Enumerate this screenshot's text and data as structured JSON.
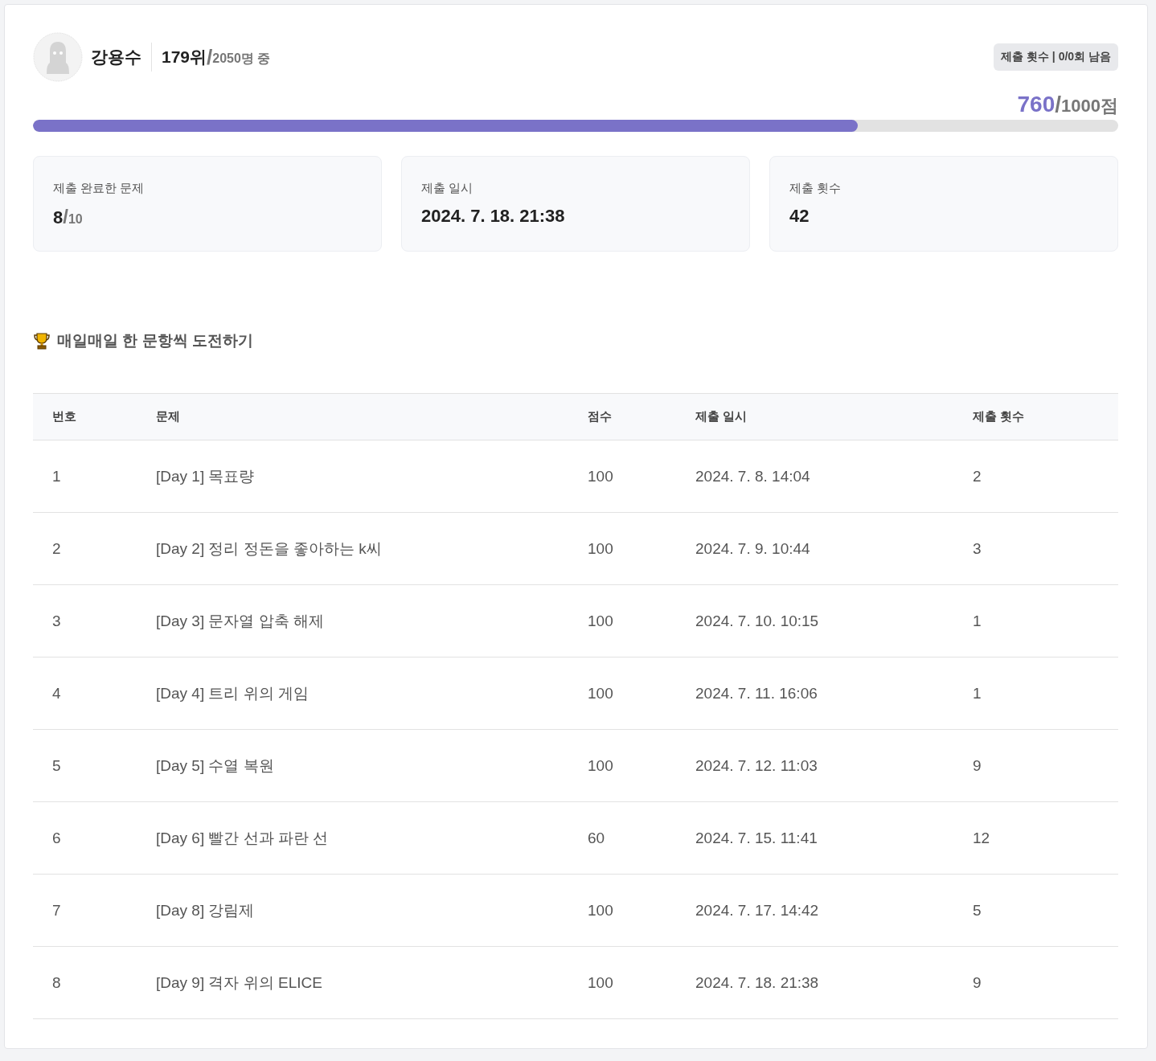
{
  "profile": {
    "name": "강용수",
    "rank": "179위",
    "rank_slash": "/",
    "total": "2050명 중",
    "attempts_badge": "제출 횟수 | 0/0회 남음",
    "score": "760",
    "score_slash": "/",
    "max_score": "1000점",
    "level": 0.76
  },
  "stats": [
    {
      "label": "제출 완료한 문제",
      "value": "8",
      "slash": "/",
      "of": "10"
    },
    {
      "label": "제출 일시",
      "value": "2024. 7. 18. 21:38"
    },
    {
      "label": "제출 횟수",
      "value": "42"
    }
  ],
  "section_title": "매일매일 한 문항씩 도전하기",
  "table": {
    "columns": [
      "번호",
      "문제",
      "점수",
      "제출 일시",
      "제출 횟수"
    ],
    "rows": [
      [
        "1",
        "[Day 1] 목표량",
        "100",
        "2024. 7. 8. 14:04",
        "2"
      ],
      [
        "2",
        "[Day 2] 정리 정돈을 좋아하는 k씨",
        "100",
        "2024. 7. 9. 10:44",
        "3"
      ],
      [
        "3",
        "[Day 3] 문자열 압축 해제",
        "100",
        "2024. 7. 10. 10:15",
        "1"
      ],
      [
        "4",
        "[Day 4] 트리 위의 게임",
        "100",
        "2024. 7. 11. 16:06",
        "1"
      ],
      [
        "5",
        "[Day 5] 수열 복원",
        "100",
        "2024. 7. 12. 11:03",
        "9"
      ],
      [
        "6",
        "[Day 6] 빨간 선과 파란 선",
        "60",
        "2024. 7. 15. 11:41",
        "12"
      ],
      [
        "7",
        "[Day 8] 강림제",
        "100",
        "2024. 7. 17. 14:42",
        "5"
      ],
      [
        "8",
        "[Day 9] 격자 위의 ELICE",
        "100",
        "2024. 7. 18. 21:38",
        "9"
      ]
    ]
  }
}
